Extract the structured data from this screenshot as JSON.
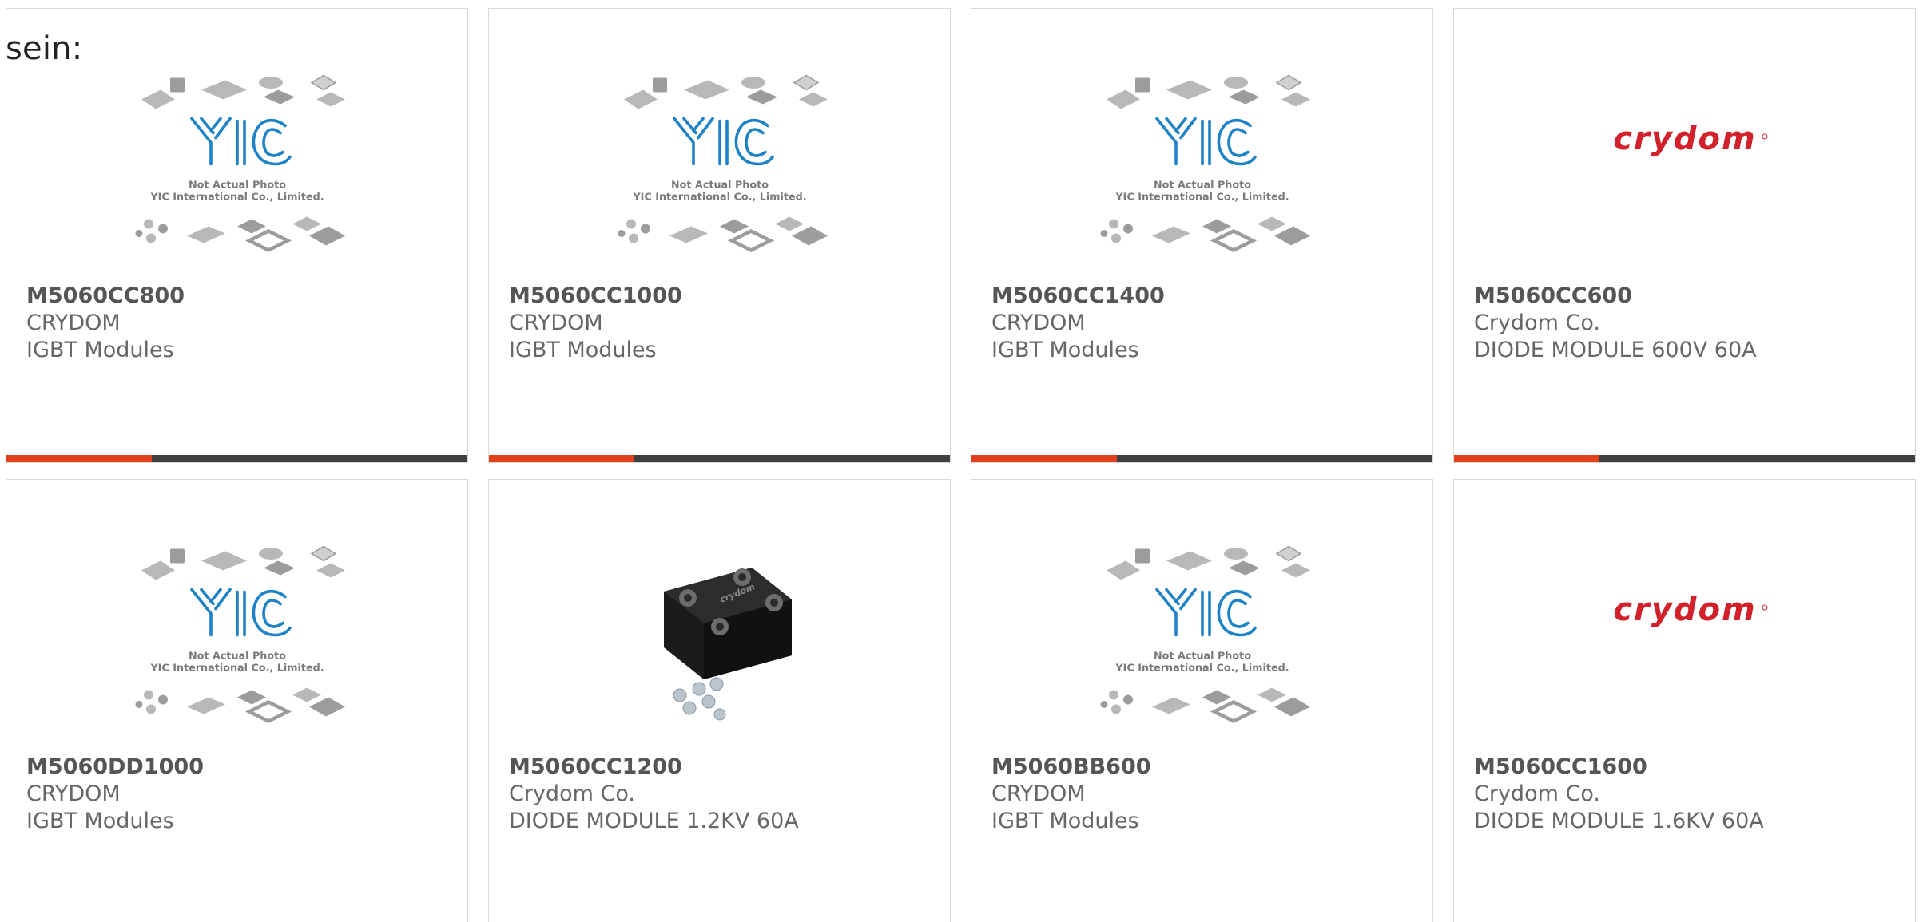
{
  "intro_text": "sein:",
  "colors": {
    "accent_orange": "#e0401b",
    "accent_dark": "#3f3f3f",
    "text_gray": "#666666",
    "yic_blue": "#1e82c6",
    "crydom_red": "#d3212c"
  },
  "products": [
    {
      "part": "M5060CC800",
      "maker": "CRYDOM",
      "description": "IGBT Modules",
      "image": "yic-placeholder-icon",
      "photo_note": "Not Actual Photo",
      "photo_company": "YIC International Co., Limited.",
      "logo_text": "YIC"
    },
    {
      "part": "M5060CC1000",
      "maker": "CRYDOM",
      "description": "IGBT Modules",
      "image": "yic-placeholder-icon",
      "photo_note": "Not Actual Photo",
      "photo_company": "YIC International Co., Limited.",
      "logo_text": "YIC"
    },
    {
      "part": "M5060CC1400",
      "maker": "CRYDOM",
      "description": "IGBT Modules",
      "image": "yic-placeholder-icon",
      "photo_note": "Not Actual Photo",
      "photo_company": "YIC International Co., Limited.",
      "logo_text": "YIC"
    },
    {
      "part": "M5060CC600",
      "maker": "Crydom Co.",
      "description": "DIODE MODULE 600V 60A",
      "image": "crydom-logo",
      "logo_text": "crydom"
    },
    {
      "part": "M5060DD1000",
      "maker": "CRYDOM",
      "description": "IGBT Modules",
      "image": "yic-placeholder-icon",
      "photo_note": "Not Actual Photo",
      "photo_company": "YIC International Co., Limited.",
      "logo_text": "YIC"
    },
    {
      "part": "M5060CC1200",
      "maker": "Crydom Co.",
      "description": "DIODE MODULE 1.2KV 60A",
      "image": "diode-module-photo",
      "logo_text": "crydom"
    },
    {
      "part": "M5060BB600",
      "maker": "CRYDOM",
      "description": "IGBT Modules",
      "image": "yic-placeholder-icon",
      "photo_note": "Not Actual Photo",
      "photo_company": "YIC International Co., Limited.",
      "logo_text": "YIC"
    },
    {
      "part": "M5060CC1600",
      "maker": "Crydom Co.",
      "description": "DIODE MODULE 1.6KV 60A",
      "image": "crydom-logo",
      "logo_text": "crydom"
    }
  ]
}
